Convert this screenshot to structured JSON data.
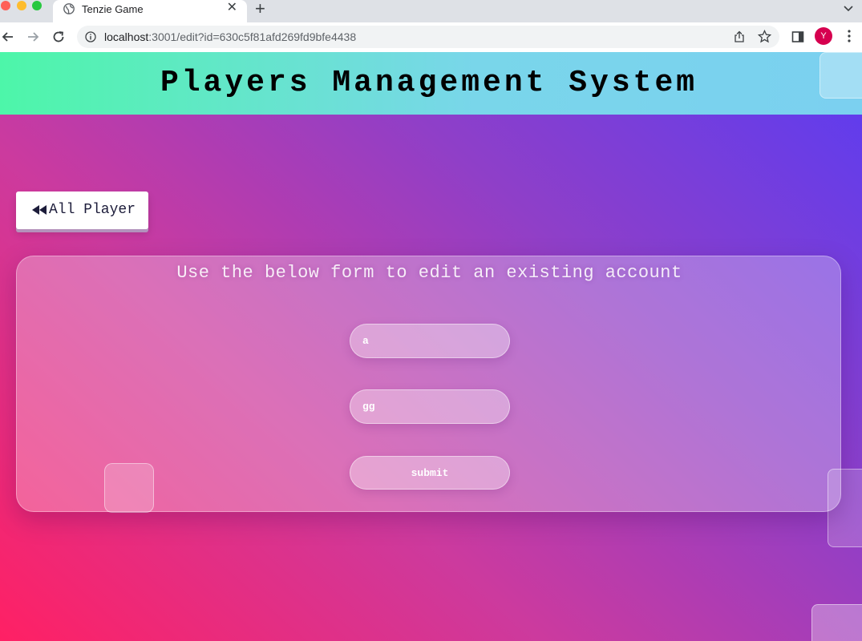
{
  "browser": {
    "tab_title": "Tenzie Game",
    "url_host": "localhost",
    "url_rest": ":3001/edit?id=630c5f81afd269fd9bfe4438",
    "avatar_initial": "Y",
    "icons": [
      "globe-icon",
      "close-icon",
      "plus-icon",
      "chevron-down-icon",
      "back-arrow-icon",
      "forward-arrow-icon",
      "reload-icon",
      "info-icon",
      "share-icon",
      "star-icon",
      "side-panel-icon",
      "kebab-menu-icon"
    ]
  },
  "header": {
    "title": "Players Management System"
  },
  "back_button": {
    "label": "All Player",
    "icon": "rewind-icon"
  },
  "form": {
    "heading": "Use the below form to edit an existing account",
    "fields": [
      {
        "value": "a"
      },
      {
        "value": "gg"
      }
    ],
    "submit_label": "submit"
  },
  "colors": {
    "header_gradient_start": "#4df6a9",
    "header_gradient_end": "#7bd0f0",
    "background_pink": "#ff2064",
    "background_purple": "#8f3fc8",
    "background_blue": "#5a3cf2",
    "avatar": "#d6004f"
  }
}
